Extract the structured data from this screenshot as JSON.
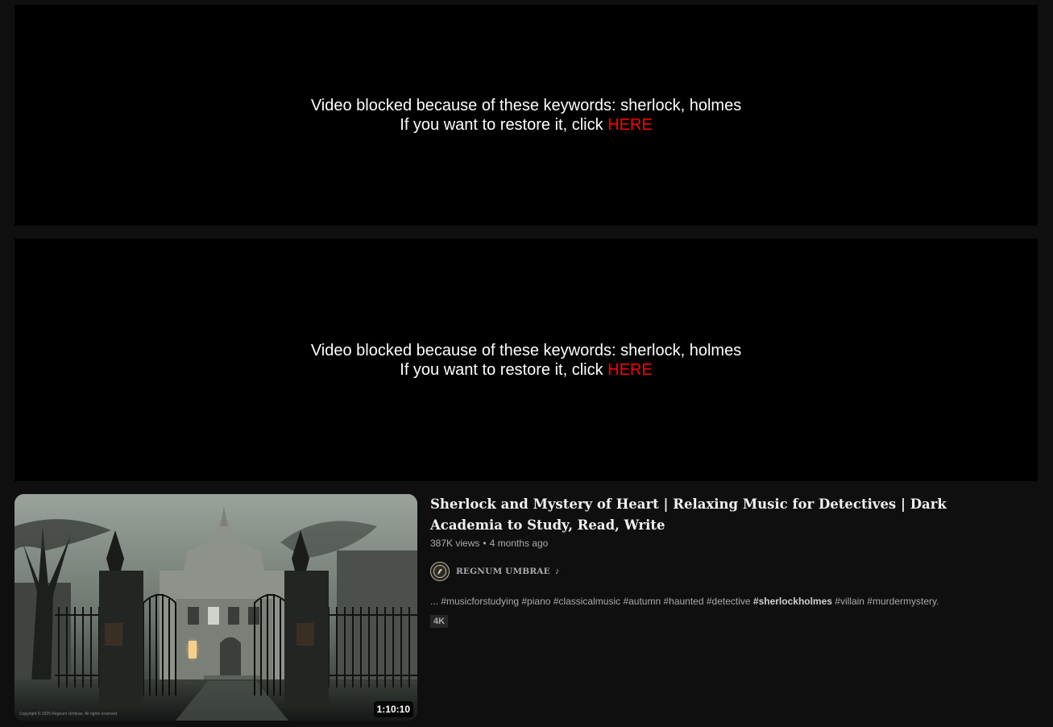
{
  "blocked_notices": [
    {
      "message": "Video blocked because of these keywords: sherlock, holmes",
      "restore_prefix": "If you want to restore it, click ",
      "restore_link": "HERE"
    },
    {
      "message": "Video blocked because of these keywords: sherlock, holmes",
      "restore_prefix": "If you want to restore it, click ",
      "restore_link": "HERE"
    }
  ],
  "video": {
    "title": "Sherlock and Mystery of Heart | Relaxing Music for Detectives | Dark Academia to Study, Read, Write",
    "views": "387K views",
    "separator": "•",
    "age": "4 months ago",
    "channel": "REGNUM UMBRAE",
    "channel_icon": "music-note-icon",
    "description_prefix": "... #musicforstudying #piano #classicalmusic #autumn #haunted #detective ",
    "description_bold": "#sherlockholmes",
    "description_suffix": " #villain #murdermystery.",
    "badge": "4K",
    "duration": "1:10:10",
    "thumbnail_copyright": "Copyright © 2025 Regnum Umbrae. All rights reserved."
  },
  "colors": {
    "background": "#0f0f0f",
    "blocked_background": "#000000",
    "link_red": "#ff0000",
    "secondary_text": "#aaaaaa"
  }
}
